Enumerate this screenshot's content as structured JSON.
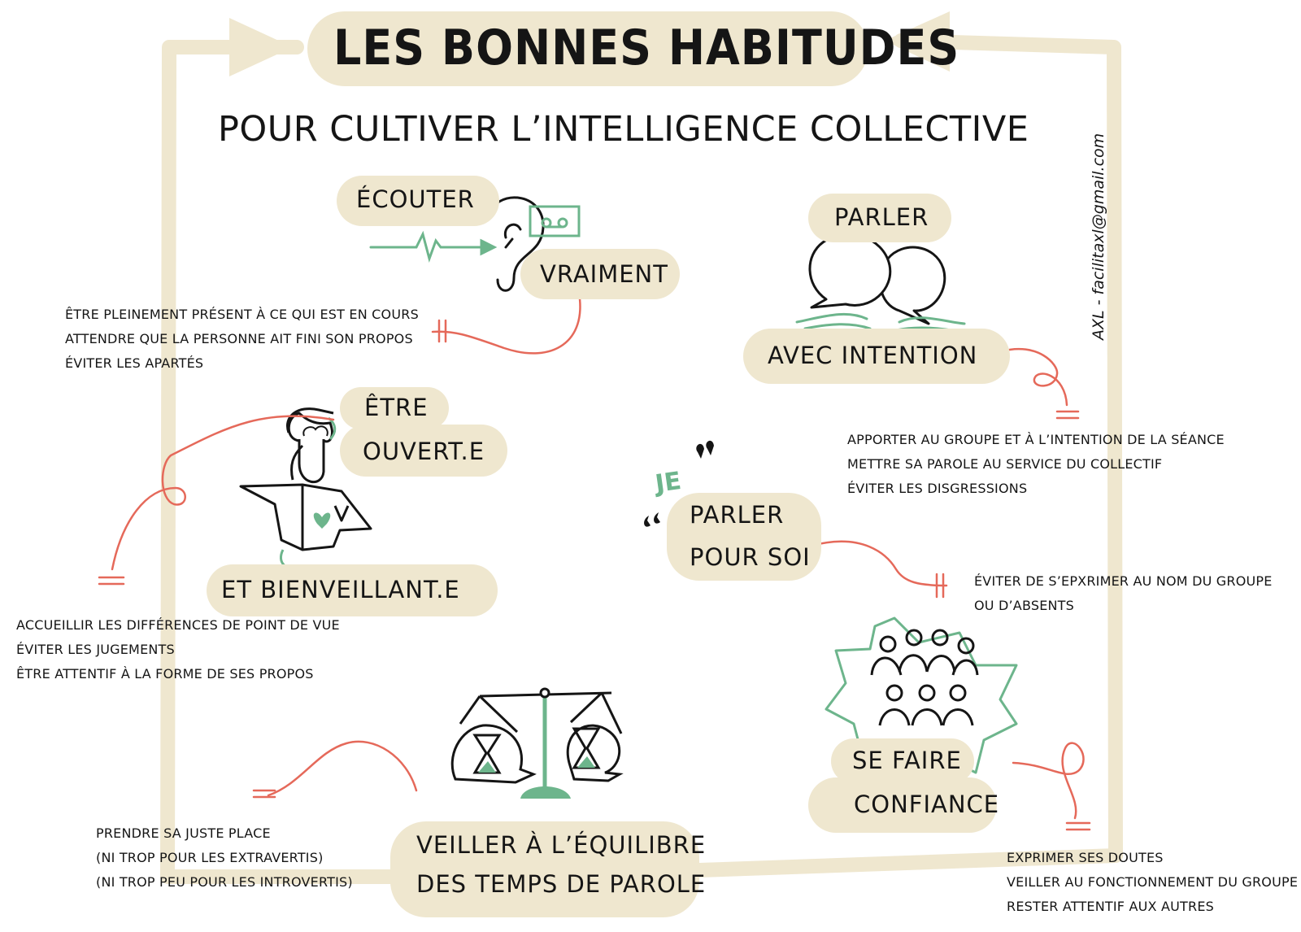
{
  "title": "LES BONNES HABITUDES",
  "subtitle": "POUR CULTIVER L’INTELLIGENCE COLLECTIVE",
  "author_credit": "AXL - facilitaxl@gmail.com",
  "habits": {
    "ecouter": {
      "label1": "ÉCOUTER",
      "label2": "VRAIMENT",
      "notes": [
        "ÊTRE PLEINEMENT PRÉSENT À CE QUI EST EN COURS",
        "ATTENDRE QUE LA PERSONNE AIT FINI SON PROPOS",
        "ÉVITER LES APARTÉS"
      ]
    },
    "parler": {
      "label1": "PARLER",
      "label2": "AVEC INTENTION",
      "notes": [
        "APPORTER AU GROUPE ET À L’INTENTION DE LA SÉANCE",
        "METTRE SA PAROLE AU SERVICE DU COLLECTIF",
        "ÉVITER LES DISGRESSIONS"
      ]
    },
    "ouvert": {
      "label1": "ÊTRE",
      "label2": "OUVERT.E",
      "label3": "ET BIENVEILLANT.E",
      "notes": [
        "ACCUEILLIR LES DIFFÉRENCES DE POINT DE VUE",
        "ÉVITER LES JUGEMENTS",
        "ÊTRE ATTENTIF À LA FORME DE SES PROPOS"
      ]
    },
    "pour_soi": {
      "quote_word": "JE",
      "label1": "PARLER",
      "label2": "POUR SOI",
      "notes": [
        "ÉVITER DE S’EPXRIMER AU NOM DU GROUPE",
        "OU D’ABSENTS"
      ]
    },
    "confiance": {
      "label1": "SE FAIRE",
      "label2": "CONFIANCE",
      "notes": [
        "EXPRIMER SES DOUTES",
        "VEILLER AU FONCTIONNEMENT DU GROUPE",
        "RESTER ATTENTIF AUX AUTRES"
      ]
    },
    "equilibre": {
      "label1": "VEILLER À L’ÉQUILIBRE",
      "label2": "DES TEMPS DE PAROLE",
      "notes": [
        "PRENDRE SA JUSTE PLACE",
        "(NI TROP POUR LES EXTRAVERTIS)",
        "(NI TROP PEU POUR LES INTROVERTIS)"
      ]
    }
  },
  "colors": {
    "beige": "#efe7cf",
    "green": "#6db58c",
    "red": "#e5695a",
    "ink": "#151515"
  },
  "icons": [
    "ear-icon",
    "cassette-icon",
    "speech-bubbles-icon",
    "hands-icon",
    "open-head-icon",
    "heart-box-icon",
    "group-people-icon",
    "balance-scale-icon",
    "hourglass-icon"
  ]
}
